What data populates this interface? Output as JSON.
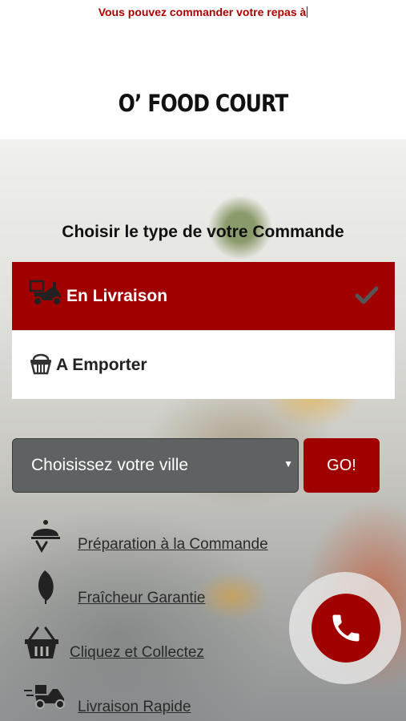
{
  "banner": {
    "text": "Vous pouvez commander votre repas à"
  },
  "brand": {
    "name": "O’ FOOD COURT"
  },
  "order": {
    "title": "Choisir le type de votre Commande",
    "options": [
      {
        "label": "En Livraison",
        "icon": "delivery-scooter-icon",
        "selected": true
      },
      {
        "label": "A Emporter",
        "icon": "basket-icon",
        "selected": false
      }
    ]
  },
  "city": {
    "selected": "Choisissez votre ville",
    "go_label": "GO!"
  },
  "features": [
    {
      "label": "Préparation à la Commande",
      "icon": "cloche-icon"
    },
    {
      "label": "Fraîcheur Garantie",
      "icon": "leaf-icon"
    },
    {
      "label": "Cliquez et Collectez",
      "icon": "basket-icon"
    },
    {
      "label": "Livraison Rapide",
      "icon": "delivery-scooter-icon"
    }
  ],
  "colors": {
    "accent": "#a10000",
    "select_bg": "#5f6262"
  }
}
